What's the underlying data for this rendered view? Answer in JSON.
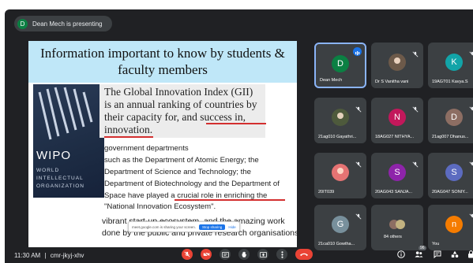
{
  "presenting": {
    "avatar_letter": "D",
    "text": "Dean Mech is presenting"
  },
  "slide": {
    "title_line1": "Information important to know by students &",
    "title_line2": "faculty members",
    "wipo": {
      "word": "WIPO",
      "line1": "WORLD",
      "line2": "INTELLECTUAL",
      "line3": "ORGANIZATION"
    },
    "gii_lines": [
      "The Global Innovation Index (GII)",
      "is an annual ranking of countries by",
      "their capacity for, and success in,",
      "innovation."
    ],
    "body_lines": [
      "government departments",
      "such as the Department of Atomic Energy; the",
      "Department of Science and Technology; the",
      "Department of Biotechnology and the Department of",
      "Space have played a crucial role in enriching the",
      "\"National Innovation Ecosystem\"."
    ],
    "tail_lines": [
      "vibrant start-up ecosystem, and the amazing work",
      "done by the public and private research organisations."
    ],
    "share_toolbar": {
      "text": "meet.google.com is sharing your screen.",
      "stop_label": "Stop sharing",
      "hide_label": "Hide"
    }
  },
  "participants": [
    {
      "name": "Dean Mech",
      "letter": "D",
      "color": "#0b8043",
      "kind": "letter",
      "speaking": true
    },
    {
      "name": "Dr S Vanitha vani",
      "letter": "",
      "color": "#6d5a4a",
      "kind": "photo",
      "speaking": false
    },
    {
      "name": "19AGT01 Kavya.S",
      "letter": "K",
      "color": "#12a4a8",
      "kind": "letter",
      "speaking": false
    },
    {
      "name": "21ag010 Gayathri...",
      "letter": "",
      "color": "#4e5a3c",
      "kind": "photo",
      "speaking": false
    },
    {
      "name": "18AG027 NITHYA...",
      "letter": "N",
      "color": "#c2185b",
      "kind": "letter",
      "speaking": false
    },
    {
      "name": "21ag007 Dhanus...",
      "letter": "D",
      "color": "#8d6e63",
      "kind": "letter",
      "speaking": false
    },
    {
      "name": "20IT039",
      "letter": "",
      "color": "#e57373",
      "kind": "profile",
      "speaking": false
    },
    {
      "name": "20AG043 SANJA...",
      "letter": "S",
      "color": "#8e24aa",
      "kind": "letter",
      "speaking": false
    },
    {
      "name": "20AG047 SONIY...",
      "letter": "S",
      "color": "#5c6bc0",
      "kind": "letter",
      "speaking": false
    },
    {
      "name": "21ca010 Gowtha...",
      "letter": "G",
      "color": "#78909c",
      "kind": "letter",
      "speaking": false
    },
    {
      "name": "84 others",
      "letter": "",
      "color": "#5f6368",
      "kind": "others",
      "speaking": false
    },
    {
      "name": "You",
      "letter": "n",
      "color": "#f57c00",
      "kind": "letter",
      "speaking": false
    }
  ],
  "bottom": {
    "time": "11:30 AM",
    "separator": "|",
    "meeting_code": "cmr-jkyj-xhv",
    "participant_count": "96"
  },
  "colors": {
    "background": "#202124",
    "tile": "#3c4043",
    "danger": "#ea4335",
    "accent": "#8ab4f8"
  }
}
